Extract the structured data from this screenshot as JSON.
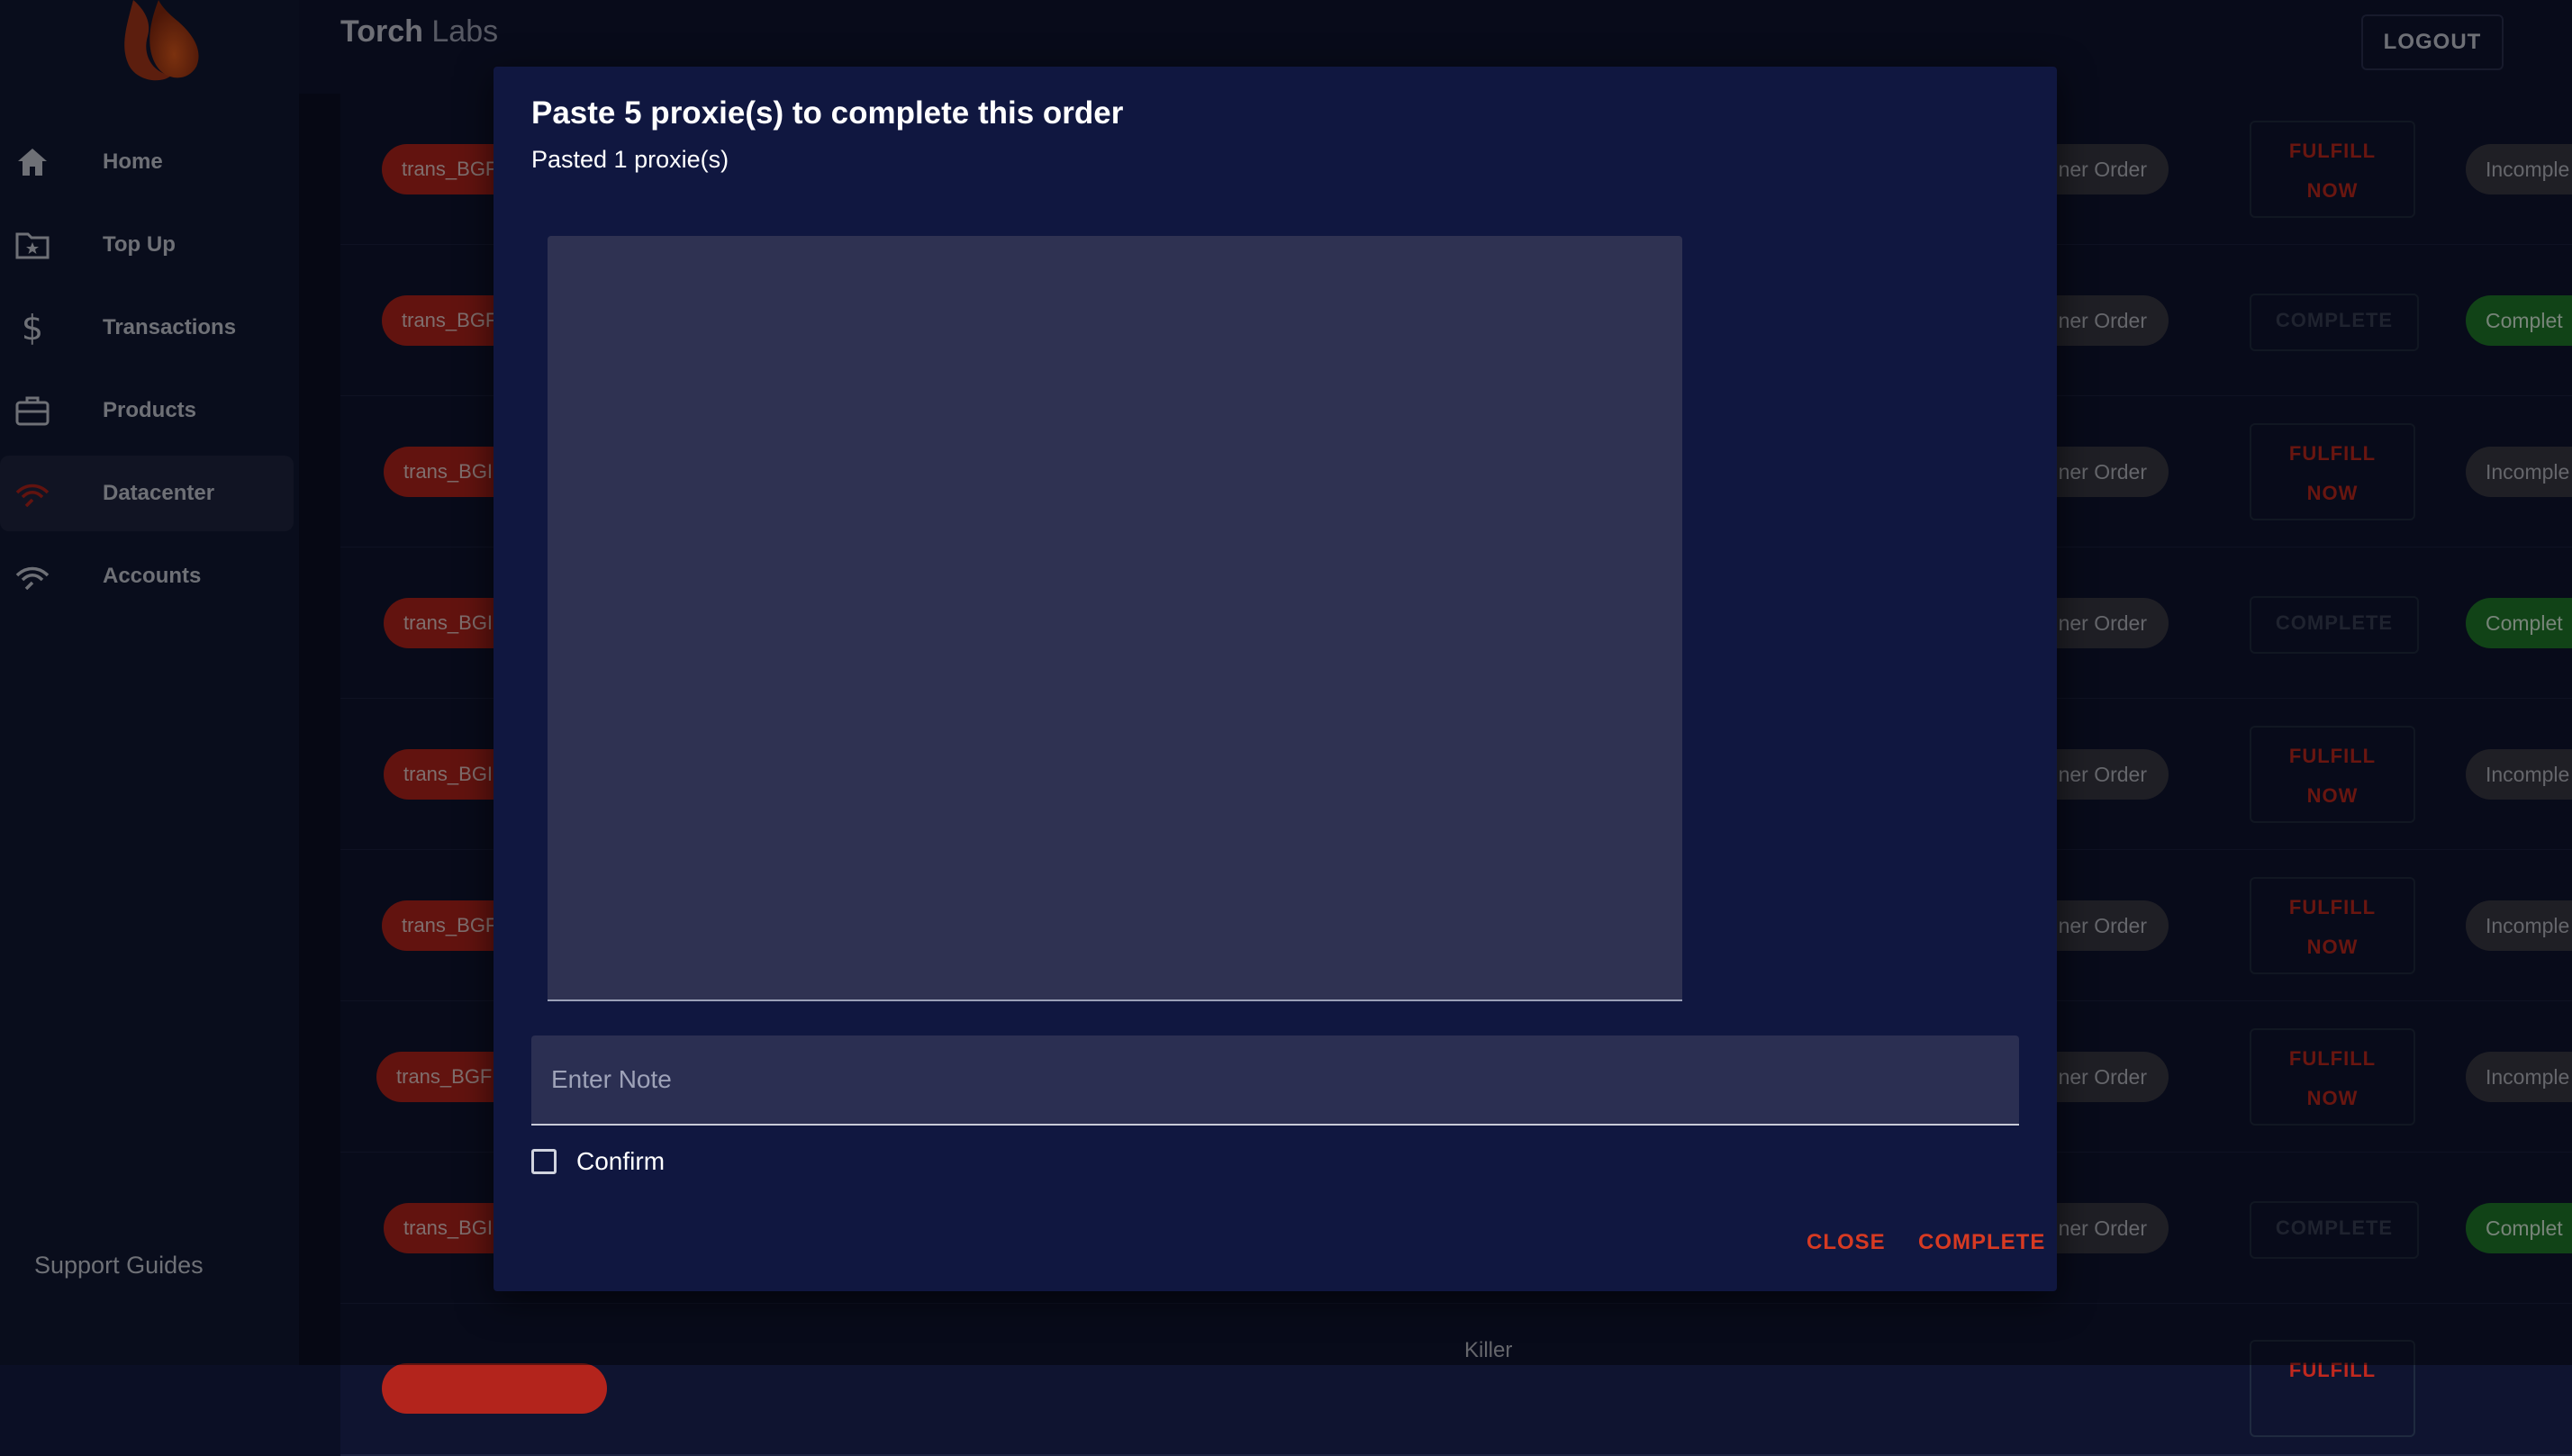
{
  "sidebar": {
    "items": [
      {
        "label": "Home",
        "icon": "home-icon"
      },
      {
        "label": "Top Up",
        "icon": "folder-star-icon"
      },
      {
        "label": "Transactions",
        "icon": "dollar-icon"
      },
      {
        "label": "Products",
        "icon": "briefcase-icon"
      },
      {
        "label": "Datacenter",
        "icon": "signal-icon",
        "active": true
      },
      {
        "label": "Accounts",
        "icon": "signal-icon"
      }
    ],
    "support": "Support Guides"
  },
  "header": {
    "brand_bold": "Torch",
    "brand_rest": " Labs",
    "logout": "LOGOUT"
  },
  "table": {
    "rows": [
      {
        "trans": "trans_BGF",
        "type": "ner Order",
        "action_line1": "FULFILL",
        "action_line2": "NOW",
        "status": "Incomple"
      },
      {
        "trans": "trans_BGF",
        "type": "ner Order",
        "action": "COMPLETE",
        "status": "Complet"
      },
      {
        "trans": "trans_BGI",
        "type": "ner Order",
        "action_line1": "FULFILL",
        "action_line2": "NOW",
        "status": "Incomple"
      },
      {
        "trans": "trans_BGI",
        "type": "ner Order",
        "action": "COMPLETE",
        "status": "Complet"
      },
      {
        "trans": "trans_BGI",
        "type": "ner Order",
        "action_line1": "FULFILL",
        "action_line2": "NOW",
        "status": "Incomple"
      },
      {
        "trans": "trans_BGF",
        "type": "ner Order",
        "action_line1": "FULFILL",
        "action_line2": "NOW",
        "status": "Incomple"
      },
      {
        "trans": "trans_BGF",
        "type": "ner Order",
        "action_line1": "FULFILL",
        "action_line2": "NOW",
        "status": "Incomple"
      },
      {
        "trans": "trans_BGI",
        "type": "ner Order",
        "action": "COMPLETE",
        "status": "Complet"
      }
    ],
    "partial_row_text": "Killer",
    "partial_row_action": "FULFILL"
  },
  "modal": {
    "title": "Paste 5 proxie(s) to complete this order",
    "subtitle": "Pasted 1 proxie(s)",
    "proxy_value": "",
    "note_placeholder": "Enter Note",
    "confirm_label": "Confirm",
    "close_label": "CLOSE",
    "complete_label": "COMPLETE"
  },
  "colors": {
    "accent": "#d73a22",
    "modal_bg": "#101740",
    "complete_green": "#1f7a2a"
  }
}
